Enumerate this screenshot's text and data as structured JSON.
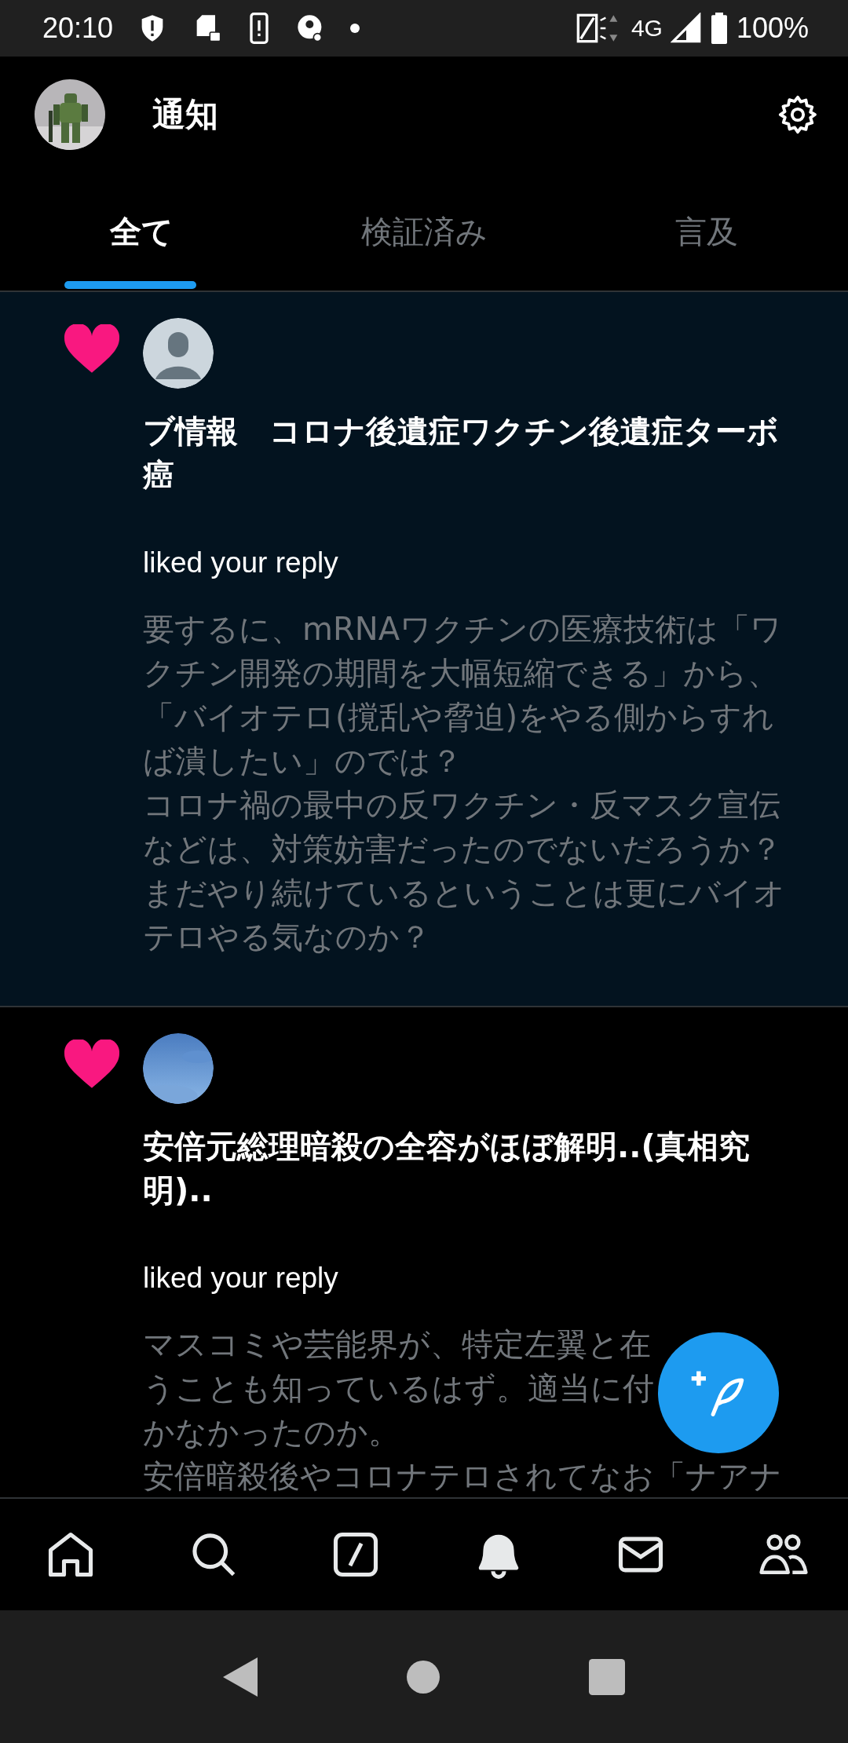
{
  "status_bar": {
    "time": "20:10",
    "network": "4G",
    "battery": "100%"
  },
  "header": {
    "title": "通知"
  },
  "tabs": [
    {
      "label": "全て",
      "selected": true
    },
    {
      "label": "検証済み",
      "selected": false
    },
    {
      "label": "言及",
      "selected": false
    }
  ],
  "notifications": [
    {
      "unread": true,
      "default_avatar": true,
      "title": "ブ情報　コロナ後遺症ワクチン後遺症ターボ癌",
      "action": "liked your reply",
      "body_lines": [
        "要するに、mRNAワクチンの医療技術は「ワクチン開発の期間を大幅短縮できる」から、「バイオテロ(撹乱や脅迫)をやる側からすれば潰したい」のでは？",
        "コロナ禍の最中の反ワクチン・反マスク宣伝などは、対策妨害だったのでないだろうか？まだやり続けているということは更にバイオテロやる気なのか？"
      ]
    },
    {
      "unread": false,
      "default_avatar": false,
      "title": "安倍元総理暗殺の全容がほぼ解明..(真相究明)..",
      "action": "liked your reply",
      "body_lines": [
        "マスコミや芸能界が、特定左翼と在",
        "うことも知っているはず。適当に付",
        "かなかったのか。",
        "安倍暗殺後やコロナテロされてなお「ナアナ"
      ]
    }
  ],
  "bottom_nav": [
    {
      "kind": "home"
    },
    {
      "kind": "search"
    },
    {
      "kind": "compose"
    },
    {
      "kind": "bell"
    },
    {
      "kind": "mail"
    },
    {
      "kind": "people"
    }
  ]
}
